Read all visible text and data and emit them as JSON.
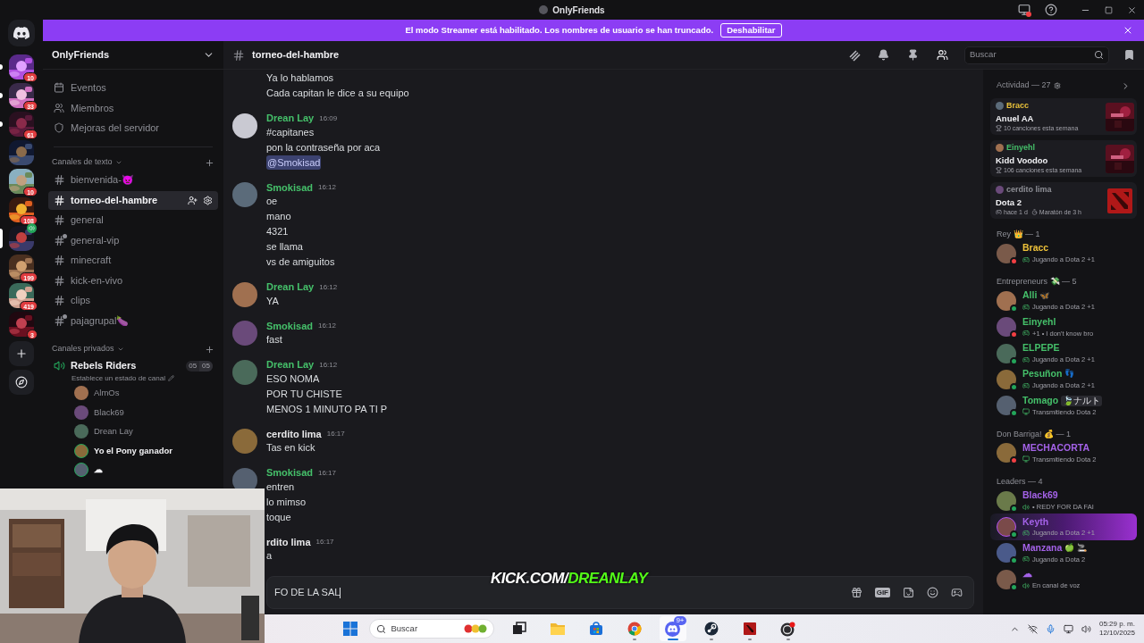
{
  "window": {
    "title": "OnlyFriends"
  },
  "banner": {
    "message": "El modo Streamer está habilitado. Los nombres de usuario se han truncado.",
    "button": "Deshabilitar"
  },
  "servers": [
    {
      "badge": "10",
      "unread": true,
      "selected": false,
      "voice": false
    },
    {
      "badge": "33",
      "unread": true,
      "selected": false,
      "voice": false
    },
    {
      "badge": "61",
      "unread": true,
      "selected": false,
      "voice": false
    },
    {
      "unread": false,
      "selected": false,
      "voice": false
    },
    {
      "badge": "10",
      "unread": false,
      "selected": false,
      "voice": false
    },
    {
      "badge": "108",
      "unread": false,
      "selected": false,
      "voice": false
    },
    {
      "unread": false,
      "selected": true,
      "voice": true
    },
    {
      "badge": "199",
      "unread": false,
      "selected": false,
      "voice": false
    },
    {
      "badge": "419",
      "unread": false,
      "selected": false,
      "voice": false
    },
    {
      "badge": "3",
      "unread": false,
      "selected": false,
      "voice": false
    }
  ],
  "server": {
    "name": "OnlyFriends"
  },
  "server_menu": [
    {
      "kind": "events",
      "label": "Eventos"
    },
    {
      "kind": "members",
      "label": "Miembros"
    },
    {
      "kind": "boosts",
      "label": "Mejoras del servidor"
    }
  ],
  "text_category": {
    "label": "Canales de texto",
    "channels": [
      {
        "name": "bienvenida-👿",
        "kind": "text",
        "selected": false
      },
      {
        "name": "torneo-del-hambre",
        "kind": "text",
        "selected": true
      },
      {
        "name": "general",
        "kind": "text",
        "selected": false
      },
      {
        "name": "general-vip",
        "kind": "restricted",
        "selected": false
      },
      {
        "name": "minecraft",
        "kind": "text",
        "selected": false
      },
      {
        "name": "kick-en-vivo",
        "kind": "text",
        "selected": false
      },
      {
        "name": "clips",
        "kind": "text",
        "selected": false
      },
      {
        "name": "pajagrupal🍆",
        "kind": "restricted",
        "selected": false
      }
    ]
  },
  "private_category": {
    "label": "Canales privados",
    "voice_channel": {
      "name": "Rebels Riders",
      "counts": [
        "05",
        "05"
      ],
      "status_hint": "Establece un estado de canal",
      "users": [
        {
          "name": "AlmOs",
          "speaking": false
        },
        {
          "name": "Black69",
          "speaking": false
        },
        {
          "name": "Drean Lay",
          "speaking": false
        },
        {
          "name": "Yo el Pony ganador",
          "speaking": true
        },
        {
          "name": "☁",
          "speaking": true
        }
      ]
    }
  },
  "channel": {
    "name": "torneo-del-hambre",
    "search_placeholder": "Buscar"
  },
  "messages": [
    {
      "kind": "continuation",
      "lines": [
        {
          "kind": "text",
          "text": "Ya lo hablamos"
        },
        {
          "kind": "text",
          "text": "Cada capitan le dice a su equipo"
        }
      ]
    },
    {
      "kind": "group",
      "author": "Drean Lay",
      "color": "#45c06a",
      "time": "16:09",
      "lines": [
        {
          "kind": "text",
          "text": "#capitanes"
        },
        {
          "kind": "text",
          "text": "pon la contraseña por aca"
        },
        {
          "kind": "mention",
          "text": "@Smokisad"
        }
      ]
    },
    {
      "kind": "group",
      "author": "Smokisad",
      "color": "#45c06a",
      "time": "16:12",
      "lines": [
        {
          "kind": "text",
          "text": "oe"
        },
        {
          "kind": "text",
          "text": "mano"
        },
        {
          "kind": "text",
          "text": "4321"
        },
        {
          "kind": "text",
          "text": "se llama"
        },
        {
          "kind": "text",
          "text": "vs de amiguitos"
        }
      ]
    },
    {
      "kind": "group",
      "author": "Drean Lay",
      "color": "#45c06a",
      "time": "16:12",
      "lines": [
        {
          "kind": "text",
          "text": "YA"
        }
      ]
    },
    {
      "kind": "group",
      "author": "Smokisad",
      "color": "#45c06a",
      "time": "16:12",
      "lines": [
        {
          "kind": "text",
          "text": "fast"
        }
      ]
    },
    {
      "kind": "group",
      "author": "Drean Lay",
      "color": "#45c06a",
      "time": "16:12",
      "lines": [
        {
          "kind": "text",
          "text": "ESO NOMA"
        },
        {
          "kind": "text",
          "text": "POR TU CHISTE"
        },
        {
          "kind": "text",
          "text": "MENOS 1 MINUTO PA TI P"
        }
      ]
    },
    {
      "kind": "group",
      "author": "cerdito lima",
      "color": "#e8e8ea",
      "time": "16:17",
      "lines": [
        {
          "kind": "text",
          "text": "Tas en kick"
        }
      ]
    },
    {
      "kind": "group",
      "author": "Smokisad",
      "color": "#45c06a",
      "time": "16:17",
      "lines": [
        {
          "kind": "text",
          "text": "entren"
        },
        {
          "kind": "text",
          "text": "lo mimso"
        },
        {
          "kind": "text",
          "text": "toque"
        }
      ]
    },
    {
      "kind": "partial",
      "author": "rdito lima",
      "color": "#e8e8ea",
      "time": "16:17",
      "lines": [
        {
          "kind": "text",
          "text": "a"
        }
      ]
    }
  ],
  "input": {
    "value": "FO DE LA SAL",
    "gif_label": "GIF"
  },
  "overlay": {
    "prefix": "KICK.COM/",
    "handle": "DREANLAY"
  },
  "activity": {
    "label": "Actividad — 27",
    "cards": [
      {
        "user": "Bracc",
        "color": "#e8c13a",
        "title": "Anuel AA",
        "kind": "album",
        "details": [
          {
            "kind": "trophy",
            "text": "10 canciones esta semana"
          }
        ]
      },
      {
        "user": "Einyehl",
        "color": "#45c06a",
        "title": "Kidd Voodoo",
        "kind": "album",
        "details": [
          {
            "kind": "trophy",
            "text": "106 canciones esta semana"
          }
        ]
      },
      {
        "user": "cerdito lima",
        "color": "#8e8f96",
        "title": "Dota 2",
        "kind": "game",
        "details": [
          {
            "kind": "game",
            "text": "hace 1 d"
          },
          {
            "kind": "timer",
            "text": "Maratón de 3 h"
          }
        ]
      }
    ]
  },
  "roles": [
    {
      "label": "Rey 👑 — 1",
      "members": [
        {
          "name": "Bracc",
          "color": "#efc33a",
          "dnd": true,
          "highlight": false,
          "activity": {
            "kind": "game",
            "text": "Jugando a Dota 2 +1"
          }
        }
      ]
    },
    {
      "label": "Entrepreneurs 💸 — 5",
      "members": [
        {
          "name": "Alli",
          "decoration": "🦋",
          "color": "#45c06a",
          "dnd": false,
          "highlight": false,
          "activity": {
            "kind": "game",
            "text": "Jugando a Dota 2 +1"
          }
        },
        {
          "name": "Einyehl",
          "color": "#45c06a",
          "dnd": true,
          "highlight": false,
          "activity": {
            "kind": "game",
            "text": "+1 • I don't know bro"
          }
        },
        {
          "name": "ELPEPE",
          "color": "#45c06a",
          "dnd": false,
          "highlight": false,
          "activity": {
            "kind": "game",
            "text": "Jugando a Dota 2 +1"
          }
        },
        {
          "name": "Pesuñon",
          "decoration": "👣",
          "color": "#45c06a",
          "dnd": false,
          "highlight": false,
          "activity": {
            "kind": "game",
            "text": "Jugando a Dota 2 +1"
          }
        },
        {
          "name": "Tomago",
          "tag": "🍃ナルト",
          "color": "#45c06a",
          "dnd": false,
          "highlight": false,
          "activity": {
            "kind": "stream",
            "text": "Transmitiendo Dota 2"
          }
        }
      ]
    },
    {
      "label": "Don Barriga! 💰 — 1",
      "members": [
        {
          "name": "MECHACORTA",
          "color": "#a462e8",
          "dnd": true,
          "highlight": false,
          "activity": {
            "kind": "stream",
            "text": "Transmitiendo Dota 2"
          }
        }
      ]
    },
    {
      "label": "Leaders — 4",
      "members": [
        {
          "name": "Black69",
          "color": "#a462e8",
          "dnd": false,
          "highlight": false,
          "activity": {
            "kind": "voice",
            "text": "• REDY FOR DA FAI"
          }
        },
        {
          "name": "Keyth",
          "color": "#a462e8",
          "dnd": false,
          "highlight": true,
          "activity": {
            "kind": "game",
            "text": "Jugando a Dota 2 +1"
          }
        },
        {
          "name": "Manzana",
          "decoration": "🍏 🚬",
          "color": "#a462e8",
          "dnd": false,
          "highlight": false,
          "activity": {
            "kind": "game",
            "text": "Jugando a Dota 2"
          }
        },
        {
          "name": "☁",
          "color": "#a462e8",
          "dnd": false,
          "highlight": false,
          "activity": {
            "kind": "voice",
            "text": "En canal de voz"
          }
        }
      ]
    }
  ],
  "taskbar": {
    "search_placeholder": "Buscar",
    "apps": [
      {
        "kind": "taskview",
        "running": false,
        "selected": false
      },
      {
        "kind": "folder",
        "running": false,
        "selected": false
      },
      {
        "kind": "store",
        "running": false,
        "selected": false
      },
      {
        "kind": "browser",
        "running": true,
        "selected": false
      },
      {
        "kind": "chat",
        "running": true,
        "selected": true,
        "badge": "9+"
      },
      {
        "kind": "steam",
        "running": true,
        "selected": false
      },
      {
        "kind": "game",
        "running": true,
        "selected": false
      },
      {
        "kind": "recorder",
        "running": true,
        "selected": false
      }
    ],
    "time": "05:29 p. m.",
    "date": "12/10/2025"
  }
}
